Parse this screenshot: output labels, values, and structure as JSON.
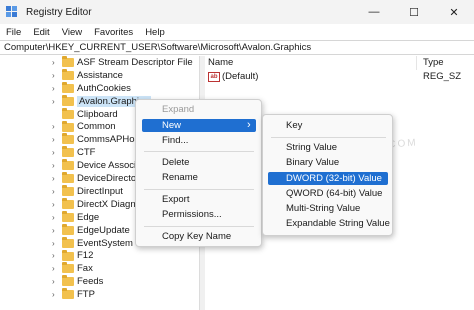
{
  "window": {
    "title": "Registry Editor",
    "controls": {
      "minimize": "—",
      "maximize": "☐",
      "close": "✕"
    }
  },
  "menubar": [
    "File",
    "Edit",
    "View",
    "Favorites",
    "Help"
  ],
  "address": "Computer\\HKEY_CURRENT_USER\\Software\\Microsoft\\Avalon.Graphics",
  "tree": {
    "items": [
      "ASF Stream Descriptor File",
      "Assistance",
      "AuthCookies",
      "Avalon.Graphics",
      "Clipboard",
      "Common",
      "CommsAPHost",
      "CTF",
      "Device Associa",
      "DeviceDirector",
      "DirectInput",
      "DirectX Diagno",
      "Edge",
      "EdgeUpdate",
      "EventSystem",
      "F12",
      "Fax",
      "Feeds",
      "FTP"
    ],
    "selected_index": 3
  },
  "list": {
    "columns": {
      "name": "Name",
      "type": "Type"
    },
    "rows": [
      {
        "icon": "ab",
        "name": "(Default)",
        "type": "REG_SZ"
      }
    ]
  },
  "context_menu": {
    "items": [
      "Expand",
      "New",
      "Find...",
      "Delete",
      "Rename",
      "Export",
      "Permissions...",
      "Copy Key Name"
    ],
    "disabled_index": 0,
    "highlighted_index": 1,
    "submenu_arrow": "›"
  },
  "submenu": {
    "items": [
      "Key",
      "String Value",
      "Binary Value",
      "DWORD (32-bit) Value",
      "QWORD (64-bit) Value",
      "Multi-String Value",
      "Expandable String Value"
    ],
    "highlighted_index": 3
  },
  "watermark": "DROIDWIN.COM",
  "colors": {
    "highlight": "#1f6fd1",
    "selection": "#cce4f7",
    "folder": "#f2c14e"
  }
}
